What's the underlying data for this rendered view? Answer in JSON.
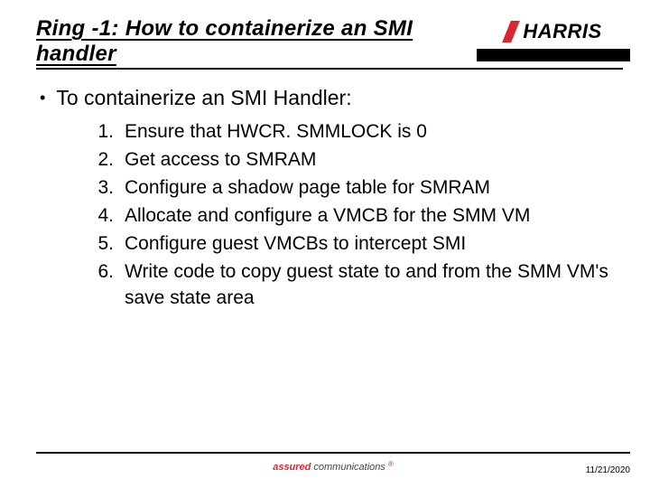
{
  "header": {
    "title": "Ring -1: How to containerize an SMI handler",
    "logo_text": "HARRIS"
  },
  "bullet": "To containerize an SMI Handler:",
  "steps": [
    "Ensure that HWCR. SMMLOCK is 0",
    "Get access to SMRAM",
    "Configure a shadow page table for SMRAM",
    "Allocate and configure a VMCB for the SMM VM",
    "Configure guest VMCBs to intercept SMI",
    "Write code to copy guest state to and from the SMM VM's save state area"
  ],
  "footer": {
    "brand_a": "assured",
    "brand_c": "communications",
    "brand_r": "®",
    "date": "11/21/2020"
  }
}
